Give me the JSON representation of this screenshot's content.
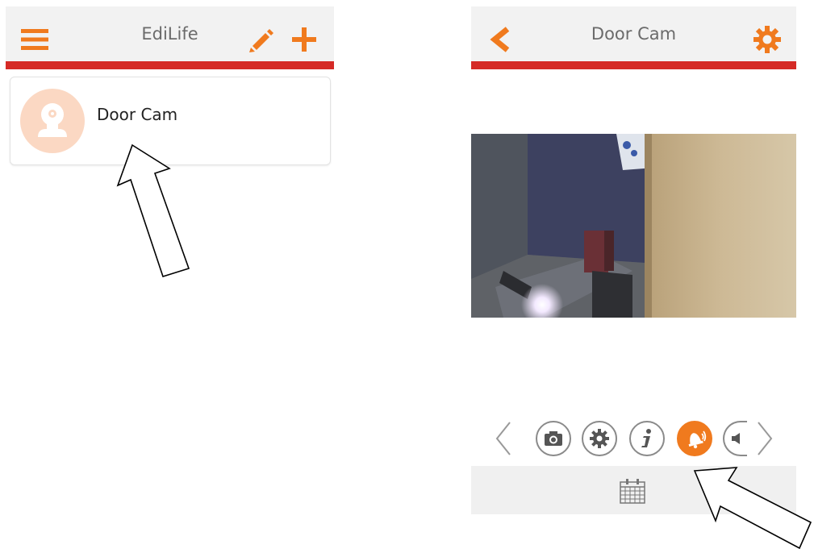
{
  "left_screen": {
    "header": {
      "title": "EdiLife",
      "menu_icon": "hamburger-menu-icon",
      "edit_icon": "pencil-icon",
      "add_icon": "plus-icon"
    },
    "devices": [
      {
        "name": "Door Cam",
        "avatar_icon": "camera-avatar-icon"
      }
    ]
  },
  "right_screen": {
    "header": {
      "title": "Door Cam",
      "back_icon": "back-chevron-icon",
      "settings_icon": "gear-icon"
    },
    "video": {
      "overlay_text": ""
    },
    "toolbar": {
      "buttons": [
        {
          "icon": "camera-icon",
          "active": false
        },
        {
          "icon": "settings-icon",
          "active": false
        },
        {
          "icon": "info-icon",
          "active": false
        },
        {
          "icon": "bell-icon",
          "active": true
        },
        {
          "icon": "speaker-icon",
          "active": false
        }
      ]
    },
    "bottom_bar": {
      "icon": "calendar-icon"
    }
  },
  "colors": {
    "accent_orange": "#f07a1e",
    "accent_red": "#d52a26",
    "header_bg": "#f2f2f2",
    "avatar_bg": "#fbd8c3"
  }
}
